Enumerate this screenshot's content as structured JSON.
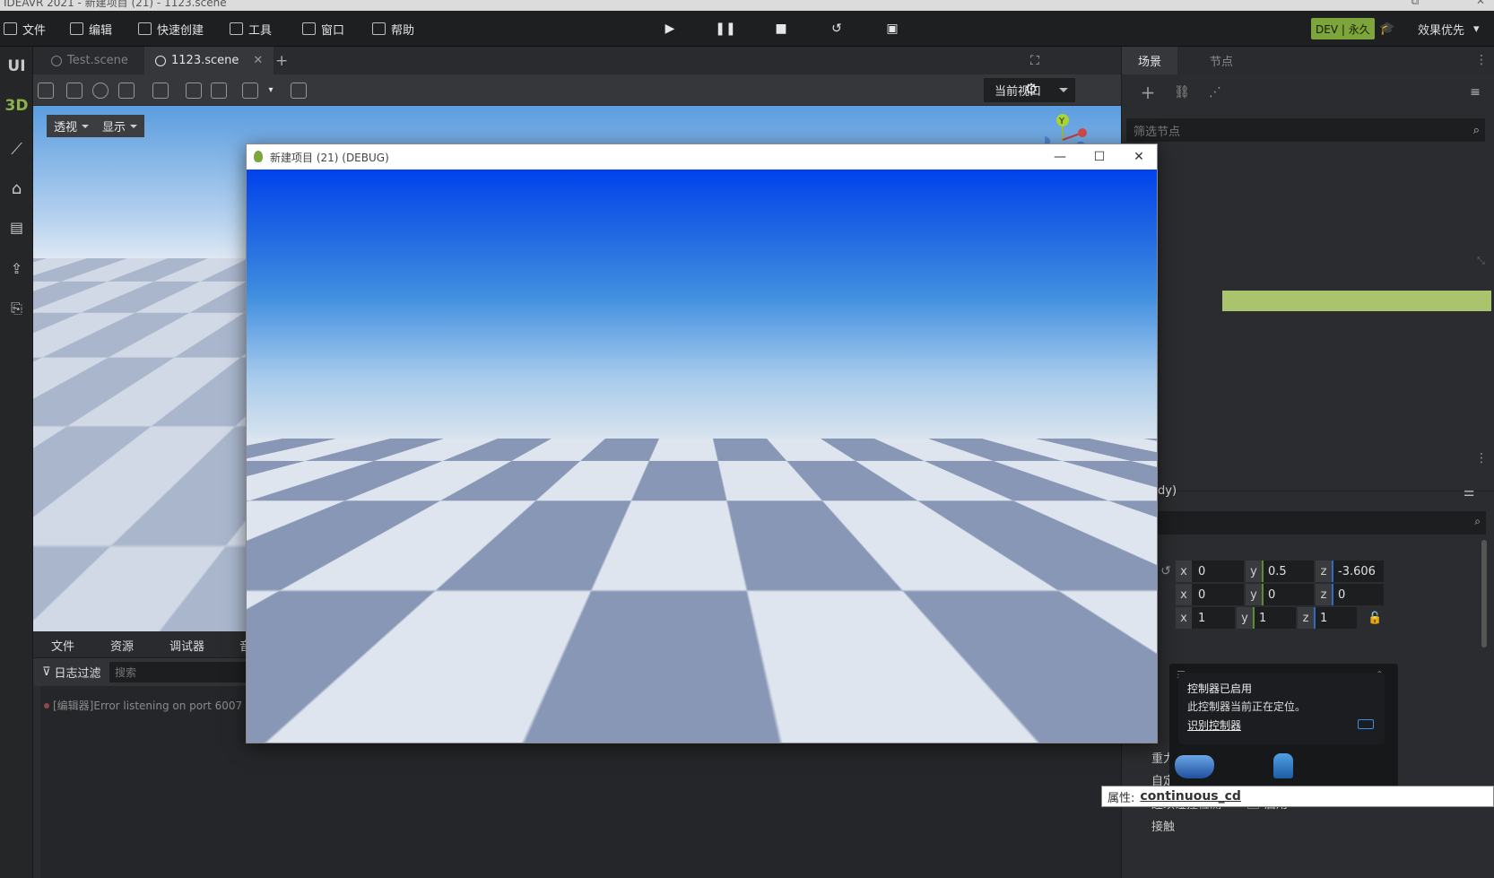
{
  "window": {
    "title": "IDEAVR 2021 - 新建项目 (21) - 1123.scene"
  },
  "menu": {
    "items": [
      {
        "label": "文件",
        "icon": "file-icon"
      },
      {
        "label": "编辑",
        "icon": "crop-icon"
      },
      {
        "label": "快速创建",
        "icon": "edit-icon"
      },
      {
        "label": "工具",
        "icon": "toolbox-icon"
      },
      {
        "label": "窗口",
        "icon": "window-icon"
      },
      {
        "label": "帮助",
        "icon": "help-icon"
      }
    ],
    "play_controls": [
      "play-icon",
      "pause-icon",
      "stop-icon",
      "undo-icon",
      "clapper-icon"
    ],
    "license_badge": "DEV | 永久",
    "quality": "效果优先"
  },
  "rail": {
    "items": [
      "UI",
      "3D"
    ]
  },
  "tabs": [
    {
      "label": "Test.scene",
      "active": false
    },
    {
      "label": "1123.scene",
      "active": true
    }
  ],
  "toolbar": {
    "view_select": "当前视口"
  },
  "viewport": {
    "projection": "透视",
    "display": "显示",
    "gizmo_axis": "Y"
  },
  "console": {
    "tabs": [
      "文件",
      "资源",
      "调试器",
      "音"
    ],
    "filter_label": "日志过滤",
    "search_placeholder": "搜索",
    "log": "[编辑器]Error listening on port 6007"
  },
  "right_panel": {
    "tabs": [
      "场景",
      "节点"
    ],
    "filter_placeholder": "筛选节点",
    "inspector_title": "dy)",
    "position": {
      "x": "0",
      "y": "0.5",
      "z": "-3.606"
    },
    "rotation": {
      "x": "0",
      "y": "0",
      "z": "0"
    },
    "scale": {
      "x": "1",
      "y": "1",
      "z": "1"
    },
    "props": [
      "重力大小",
      "自定义积分器",
      "连续碰撞检测",
      "接触"
    ],
    "enable_label": "启用"
  },
  "popup": {
    "title": "控制器已启用",
    "body": "此控制器当前正在定位。",
    "link": "识别控制器"
  },
  "tooltip": {
    "label": "属性:",
    "value": "continuous_cd"
  },
  "debug_window": {
    "title": "新建项目 (21) (DEBUG)"
  },
  "colors": {
    "accent_green": "#7ea53b",
    "selection": "#a9c46d",
    "sky_blue": "#0042ec"
  }
}
